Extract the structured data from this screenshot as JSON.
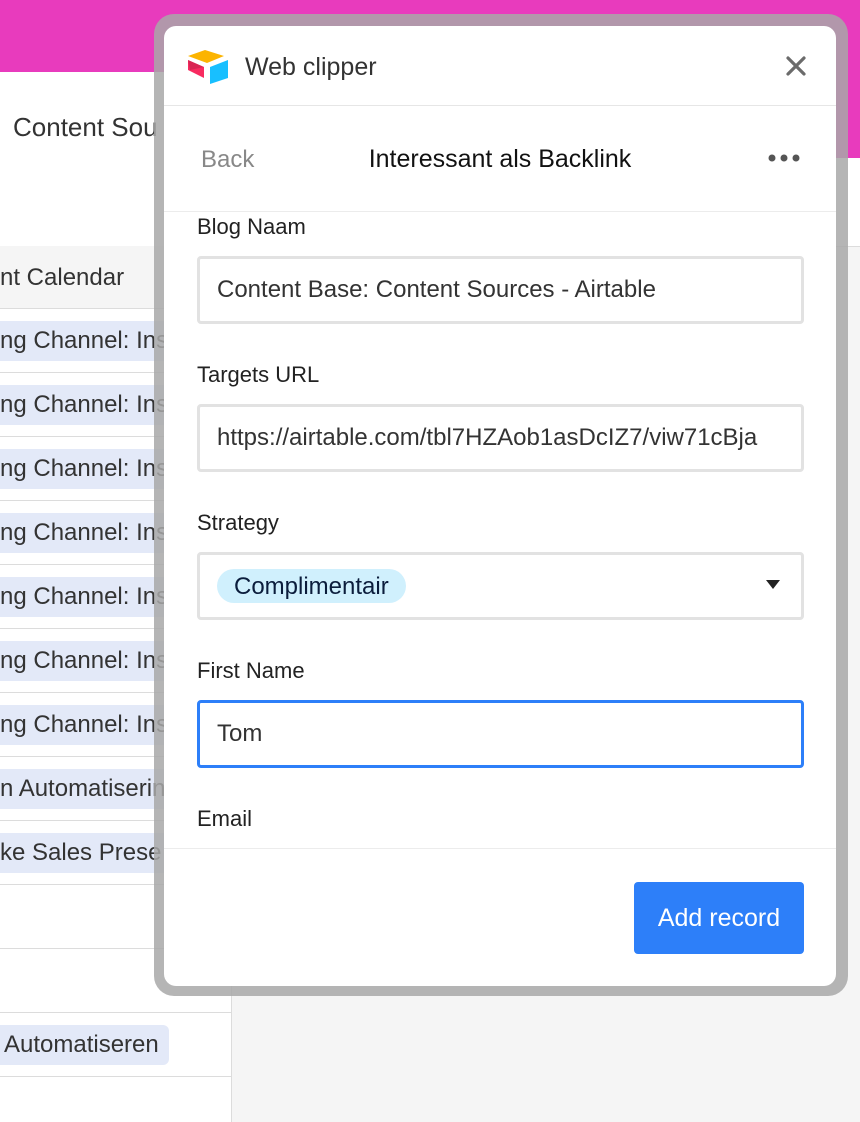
{
  "background": {
    "title": "Content Sou",
    "column_header": "nt Calendar",
    "rows": [
      "ng Channel: Ins",
      "ng Channel: Ins",
      "ng Channel: Ins",
      "ng Channel: Ins",
      "ng Channel: Ins",
      "ng Channel: Ins",
      "ng Channel: Ins",
      "n Automatiserin",
      "ke Sales Prese",
      "",
      "",
      "Automatiseren"
    ]
  },
  "clipper": {
    "title": "Web clipper",
    "close_icon": "close-icon",
    "logo_icon": "airtable-logo-icon"
  },
  "form": {
    "back_label": "Back",
    "title": "Interessant als Backlink",
    "more_icon": "more-dots-icon",
    "fields": [
      {
        "label": "Blog Naam",
        "value": "Content Base: Content Sources - Airtable"
      },
      {
        "label": "Targets URL",
        "value": "https://airtable.com/tbl7HZAob1asDcIZ7/viw71cBja"
      },
      {
        "label": "Strategy",
        "value": "Complimentair"
      },
      {
        "label": "First Name",
        "value": "Tom"
      },
      {
        "label": "Email",
        "value": ""
      }
    ],
    "submit_label": "Add record"
  },
  "colors": {
    "brand_bar": "#e83bbd",
    "accent_blue": "#2d7ff9",
    "chip_blue": "#d0f0fd",
    "row_chip": "#e3e9f8"
  }
}
